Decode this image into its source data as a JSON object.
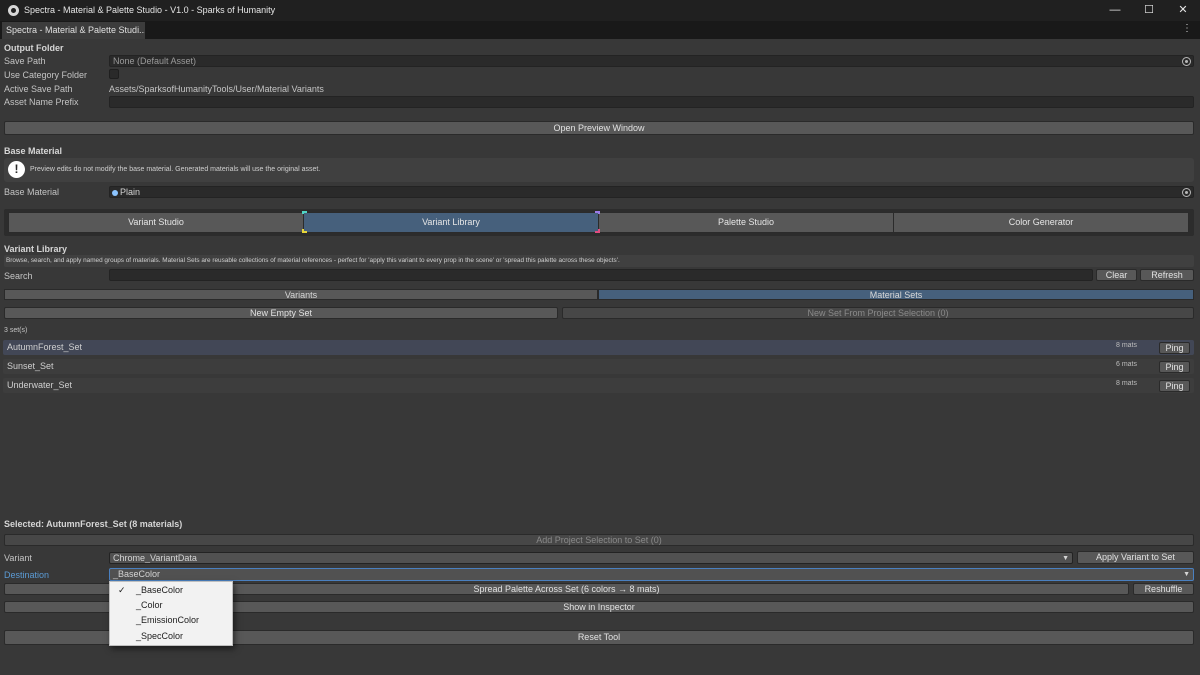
{
  "window": {
    "title": "Spectra - Material & Palette Studio -  V1.0 - Sparks of Humanity",
    "controls": {
      "minimize": "—",
      "maximize": "☐",
      "close": "✕"
    }
  },
  "tab": {
    "label": "Spectra - Material & Palette Studi...",
    "menu": "⋮"
  },
  "output_folder": {
    "heading": "Output Folder",
    "save_path_label": "Save Path",
    "save_path_value": "None (Default Asset)",
    "use_category_label": "Use Category Folder",
    "use_category_checked": false,
    "active_save_path_label": "Active Save Path",
    "active_save_path_value": "Assets/SparksofHumanityTools/User/Material Variants",
    "asset_prefix_label": "Asset Name Prefix",
    "asset_prefix_value": ""
  },
  "preview_button": "Open Preview Window",
  "base_material": {
    "heading": "Base Material",
    "info_text": "Preview edits do not modify the base material. Generated materials will use the original asset.",
    "label": "Base Material",
    "value": "Plain"
  },
  "toolbar_tabs": [
    {
      "label": "Variant Studio",
      "active": false
    },
    {
      "label": "Variant Library",
      "active": true
    },
    {
      "label": "Palette Studio",
      "active": false
    },
    {
      "label": "Color Generator",
      "active": false
    }
  ],
  "library": {
    "heading": "Variant Library",
    "description": "Browse, search, and apply named groups of materials. Material Sets are reusable collections of material references - perfect for 'apply this variant to every prop in the scene' or 'spread this palette across these objects'.",
    "search_label": "Search",
    "search_value": "",
    "clear_label": "Clear",
    "refresh_label": "Refresh",
    "subtabs": [
      {
        "label": "Variants",
        "active": false
      },
      {
        "label": "Material Sets",
        "active": true
      }
    ],
    "new_empty_label": "New Empty Set",
    "new_from_selection_label": "New Set From Project Selection (0)",
    "count_text": "3 set(s)",
    "sets": [
      {
        "name": "AutumnForest_Set",
        "count": "8 mats",
        "ping": "Ping"
      },
      {
        "name": "Sunset_Set",
        "count": "6 mats",
        "ping": "Ping"
      },
      {
        "name": "Underwater_Set",
        "count": "8 mats",
        "ping": "Ping"
      }
    ]
  },
  "selected": {
    "heading": "Selected: AutumnForest_Set  (8 materials)",
    "add_selection_label": "Add Project Selection to Set (0)",
    "variant_label": "Variant",
    "variant_value": "Chrome_VariantData",
    "apply_variant_label": "Apply Variant to Set",
    "destination_label": "Destination",
    "destination_value": "_BaseColor",
    "spread_label": "Spread Palette Across Set (6 colors → 8 mats)",
    "reshuffle_label": "Reshuffle",
    "inspector_label": "Show in Inspector"
  },
  "reset_label": "Reset Tool",
  "dropdown": {
    "options": [
      {
        "label": "_BaseColor",
        "checked": "✓"
      },
      {
        "label": "_Color",
        "checked": ""
      },
      {
        "label": "_EmissionColor",
        "checked": ""
      },
      {
        "label": "_SpecColor",
        "checked": ""
      }
    ]
  },
  "colors": {
    "accent_tab": "#46607c",
    "destination_label": "#5b9bd5",
    "info_icon": "#ffffff",
    "window_bg": "#383838"
  }
}
